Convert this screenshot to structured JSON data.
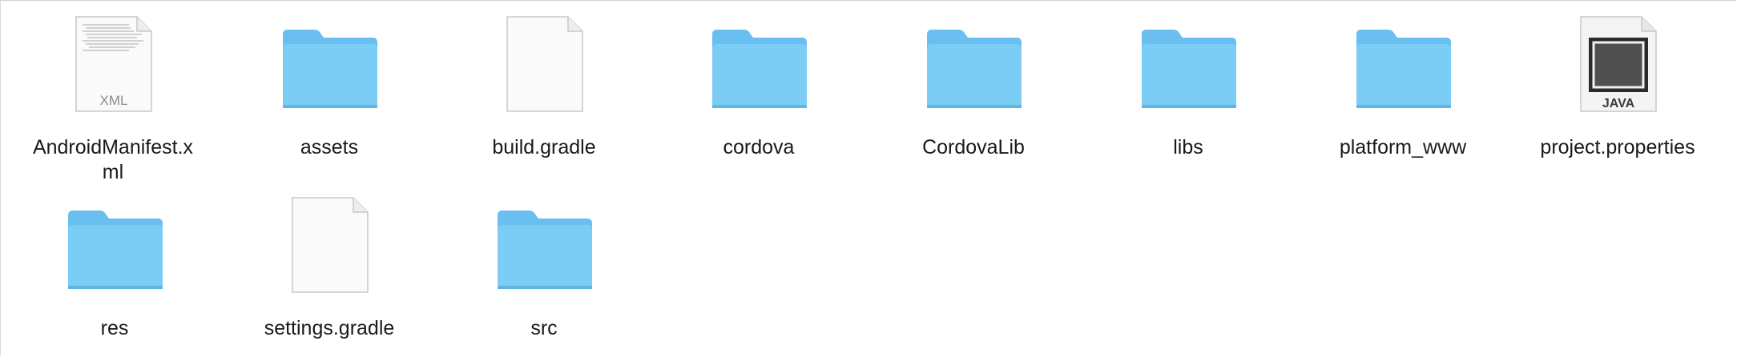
{
  "window": {
    "view": "icon-view"
  },
  "colors": {
    "folder_body": "#7ccdf6",
    "folder_tab": "#69bff0",
    "document_page": "#fafafa",
    "text": "#1a1a1a"
  },
  "files": [
    {
      "name": "AndroidManifest.xml",
      "kind": "xml-file",
      "icon": "xml-document-icon",
      "badge": "XML"
    },
    {
      "name": "assets",
      "kind": "folder",
      "icon": "folder-icon"
    },
    {
      "name": "build.gradle",
      "kind": "document",
      "icon": "blank-document-icon"
    },
    {
      "name": "cordova",
      "kind": "folder",
      "icon": "folder-icon"
    },
    {
      "name": "CordovaLib",
      "kind": "folder",
      "icon": "folder-icon"
    },
    {
      "name": "libs",
      "kind": "folder",
      "icon": "folder-icon"
    },
    {
      "name": "platform_www",
      "kind": "folder",
      "icon": "folder-icon"
    },
    {
      "name": "project.properties",
      "kind": "java-file",
      "icon": "java-document-icon",
      "badge": "JAVA"
    },
    {
      "name": "res",
      "kind": "folder",
      "icon": "folder-icon"
    },
    {
      "name": "settings.gradle",
      "kind": "document",
      "icon": "blank-document-icon"
    },
    {
      "name": "src",
      "kind": "folder",
      "icon": "folder-icon"
    }
  ]
}
